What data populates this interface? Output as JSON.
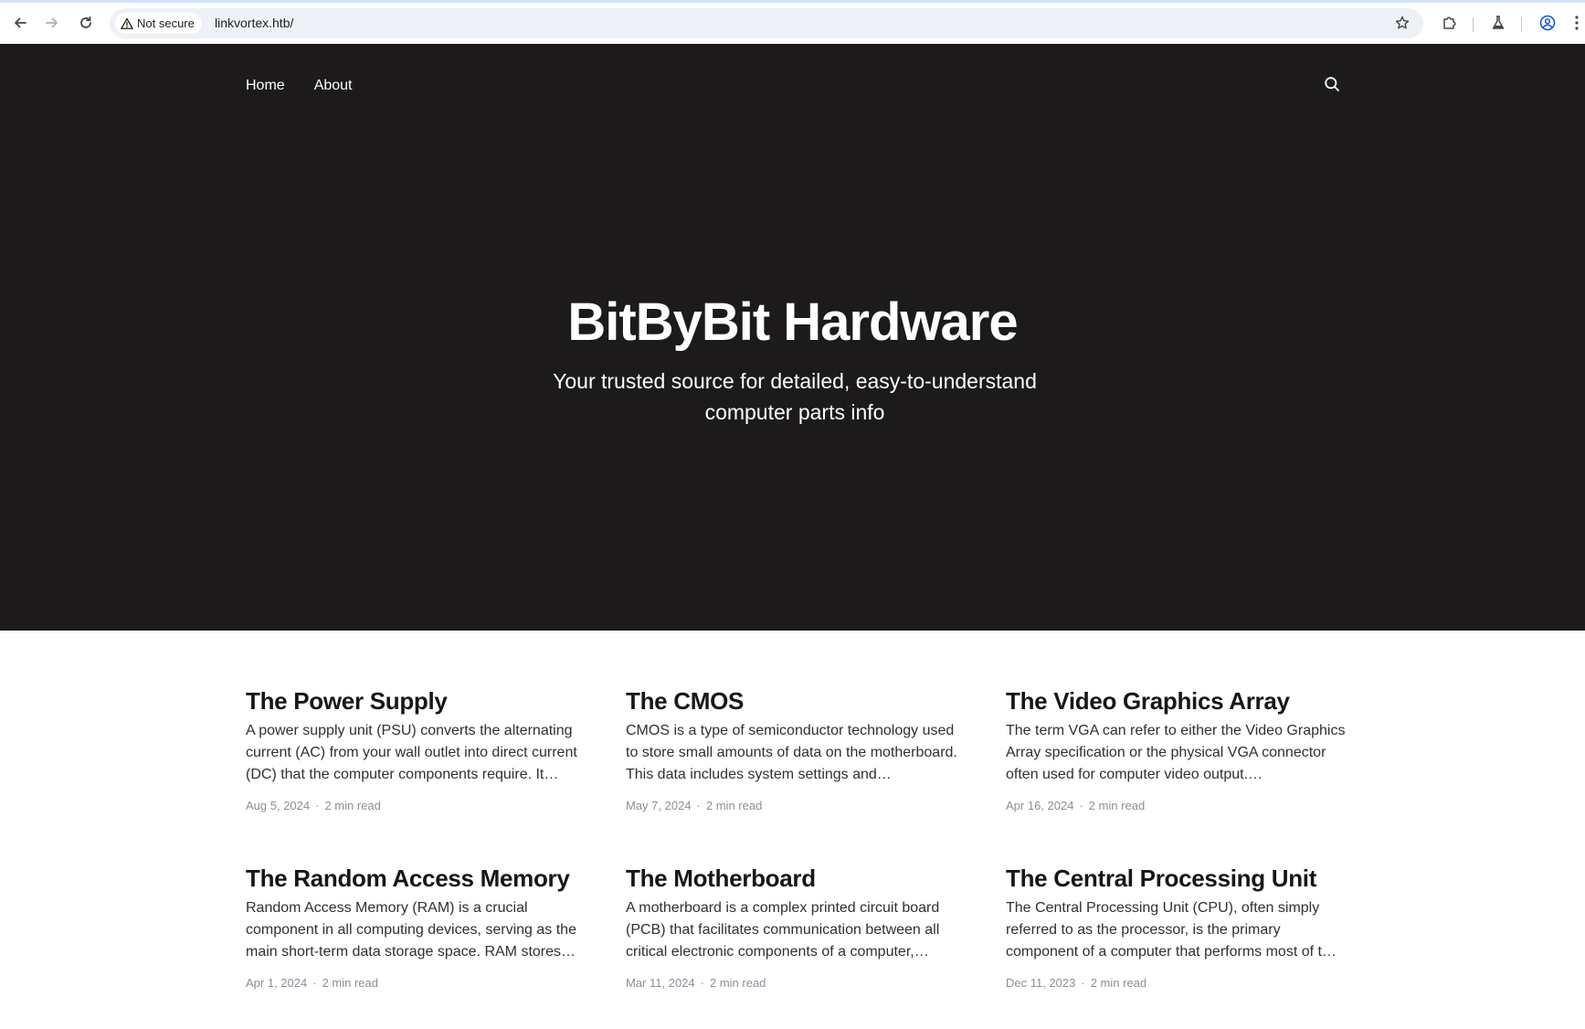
{
  "browser": {
    "security_label": "Not secure",
    "url": "linkvortex.htb/"
  },
  "site": {
    "nav": [
      {
        "label": "Home"
      },
      {
        "label": "About"
      }
    ],
    "title": "BitByBit Hardware",
    "description": "Your trusted source for detailed, easy-to-understand computer parts info"
  },
  "posts": [
    {
      "title": "The Power Supply",
      "excerpt": "A power supply unit (PSU) converts the alternating current (AC) from your wall outlet into direct current (DC) that the computer components require. It…",
      "date": "Aug 5, 2024",
      "read_time": "2 min read"
    },
    {
      "title": "The CMOS",
      "excerpt": "CMOS is a type of semiconductor technology used to store small amounts of data on the motherboard. This data includes system settings and…",
      "date": "May 7, 2024",
      "read_time": "2 min read"
    },
    {
      "title": "The Video Graphics Array",
      "excerpt": "The term VGA can refer to either the Video Graphics Array specification or the physical VGA connector often used for computer video output.…",
      "date": "Apr 16, 2024",
      "read_time": "2 min read"
    },
    {
      "title": "The Random Access Memory",
      "excerpt": "Random Access Memory (RAM) is a crucial component in all computing devices, serving as the main short-term data storage space. RAM stores…",
      "date": "Apr 1, 2024",
      "read_time": "2 min read"
    },
    {
      "title": "The Motherboard",
      "excerpt": "A motherboard is a complex printed circuit board (PCB) that facilitates communication between all critical electronic components of a computer,…",
      "date": "Mar 11, 2024",
      "read_time": "2 min read"
    },
    {
      "title": "The Central Processing Unit",
      "excerpt": "The Central Processing Unit (CPU), often simply referred to as the processor, is the primary component of a computer that performs most of t…",
      "date": "Dec 11, 2023",
      "read_time": "2 min read"
    }
  ],
  "colors": {
    "hero_bg": "#1d1a1b",
    "text": "#15171a",
    "meta": "#8a8f98"
  }
}
